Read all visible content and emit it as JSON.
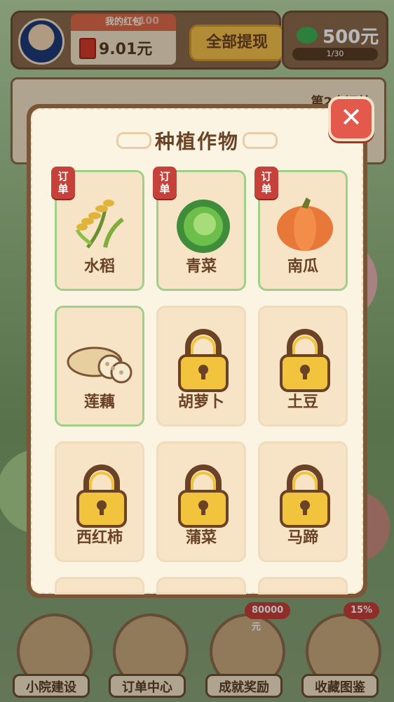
{
  "hud": {
    "redpack_title": "我的红包",
    "redpack_value": "9.01元",
    "plus_float": "+100",
    "withdraw_label": "全部提现",
    "cash_value": "500元",
    "cash_progress": "1/30"
  },
  "order_panel": {
    "label": "第2个订单"
  },
  "modal": {
    "title": "种植作物",
    "close_label": "✕",
    "order_tag_chars": [
      "订",
      "单"
    ],
    "crops": [
      {
        "name": "水稻",
        "unlocked": true,
        "order": true,
        "icon": "rice-icon"
      },
      {
        "name": "青菜",
        "unlocked": true,
        "order": true,
        "icon": "cabbage-icon"
      },
      {
        "name": "南瓜",
        "unlocked": true,
        "order": true,
        "icon": "pumpkin-icon"
      },
      {
        "name": "莲藕",
        "unlocked": true,
        "order": false,
        "icon": "lotus-root-icon"
      },
      {
        "name": "胡萝卜",
        "unlocked": false,
        "order": false,
        "icon": "lock-icon"
      },
      {
        "name": "土豆",
        "unlocked": false,
        "order": false,
        "icon": "lock-icon"
      },
      {
        "name": "西红柿",
        "unlocked": false,
        "order": false,
        "icon": "lock-icon"
      },
      {
        "name": "蒲菜",
        "unlocked": false,
        "order": false,
        "icon": "lock-icon"
      },
      {
        "name": "马蹄",
        "unlocked": false,
        "order": false,
        "icon": "lock-icon"
      }
    ]
  },
  "bottom_nav": [
    {
      "label": "小院建设",
      "badge": ""
    },
    {
      "label": "订单中心",
      "badge": ""
    },
    {
      "label": "成就奖励",
      "badge": "80000元"
    },
    {
      "label": "收藏图鉴",
      "badge": "15%"
    }
  ],
  "colors": {
    "accent_green": "#9fd08a",
    "tag_red": "#c6413a",
    "card_bg": "#f7e3c5",
    "title_brown": "#6a4225"
  }
}
